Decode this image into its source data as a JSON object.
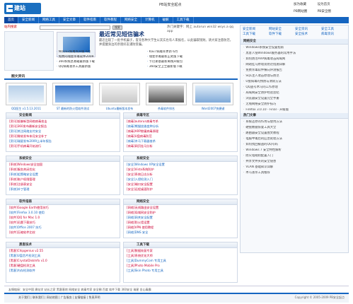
{
  "header": {
    "logo_text": "建站",
    "site_title": "PB站安全起点",
    "top_links": [
      "加为收藏",
      "设为首页",
      "PB网站圈",
      "PB安全圈"
    ]
  },
  "nav": {
    "items": [
      "首页",
      "安全新闻",
      "网络工具",
      "安全文章",
      "软件指南",
      "软件教程",
      "网络安全",
      "计算机",
      "破解",
      "工具下载"
    ]
  },
  "search": {
    "label": "站内搜索",
    "placeholder": "",
    "button": "搜索",
    "hot": "热门关键字：网上 autorun win32 wsys.a qq app"
  },
  "feature": {
    "title": "最近常见短信骗术",
    "text": "最近出现了一批手机骗子，冒充各种大学生以其实也有人来报名，以此骗取钱财。请大家注意防范，并提醒身边的亲朋好友谨防受骗。"
  },
  "list_a": [
    [
      "NOD32病毒库升级 6月",
      "Kav7病毒库更新 6月"
    ],
    [
      "免费的瑞星杀毒软件2009",
      "瑞星杀毒最新正式版下载"
    ],
    [
      "360系统急救箱最新版下载",
      "卡巴斯基最新离线升级包"
    ],
    [
      "QQ病毒查杀工具最新版",
      "360安全卫士最新版下载"
    ]
  ],
  "pictures": {
    "heading": "图文资讯",
    "captions": [
      "QQ医生 v1.5.13.2011",
      "ST 最新的防火墙软件测试",
      "Ubuntu最新版本发布",
      "杀毒软件排名",
      "Word2007快捷键"
    ]
  },
  "sidebar": {
    "tags": [
      "安全新闻",
      "网站安全",
      "安全资讯",
      "安全工具",
      "工具下载",
      "软件下载",
      "安全技术",
      "病毒资讯"
    ],
    "hot_title": "网络安全",
    "hot_items": [
      "Windows系统安全设置指南",
      "黑客入侵Windows服务器的常用手法",
      "如何防范ARP病毒攻击局域网",
      "网站挂马原理及防范措施详解",
      "免费杀毒软件横向评测报告",
      "SQL注入攻击原理与防范",
      "U盘病毒的预防与清除方法",
      "QQ盗号木马的工作原理",
      "局域网安全防护经验总结",
      "浏览器安全设置完全手册",
      "无线网络安全防护技巧",
      "Firefox 3.0.10 - Final - 升级版"
    ],
    "rank_title": "热门文章",
    "rank_items": [
      "系统还原的作用与使用方法",
      "硬盘数据恢复工具大全",
      "路由器安全设置图文教程",
      "电脑中毒后的应急处理方法",
      "如何找回被盗的QQ号码",
      "Windows 7 安全特性解析",
      "防火墙规则配置入门",
      "共享文件夹的安全隐患",
      "VLAN 基础知识详解",
      "木马查杀工具推荐"
    ]
  },
  "panels": [
    {
      "title": "安全新闻",
      "rows": [
        "[资讯]抵御新型网络病毒攻击",
        "[资讯]360发布最新安全报告",
        "[资讯]关注网络支付安全",
        "[资讯]微软发布本月安全补丁",
        "[资讯]瑞星发布2009上半年报告",
        "[资讯]手机病毒开始流行"
      ]
    },
    {
      "title": "病毒专区",
      "rows": [
        "[病毒]autorun病毒专杀",
        "[病毒]熊猫烧香变种分析",
        "[病毒]ARP欺骗病毒原理",
        "[病毒]U盘病毒防范",
        "[病毒]木马下载器查杀",
        "[病毒]网页挂马分析"
      ]
    },
    {
      "title": "系统安全",
      "rows": [
        "[系统]Windows安全加固",
        "[系统]服务关闭优化",
        "[系统]组策略安全设置",
        "[系统]账户权限管理",
        "[系统]注册表安全",
        "[系统]补丁管理"
      ]
    },
    {
      "title": "系统安全",
      "rows": [
        "[安全]Windows XP安全设置",
        "[安全]Vista系统防护",
        "[安全]系统日志分析",
        "[安全]入侵检测入门",
        "[安全]端口安全配置",
        "[安全]远程桌面防护"
      ]
    },
    {
      "title": "软件指南",
      "rows": [
        "[软件]Google Earth使用技巧",
        "[软件]Firefox 3.0.10 使用",
        "[软件]QQ for Mac 1.0",
        "[软件]迅雷下载技巧",
        "[软件]Office 2007 技巧",
        "[软件]压缩软件比较"
      ]
    },
    {
      "title": "网络安全",
      "rows": [
        "[网络]无线路由安全设置",
        "[网络]局域网安全防护",
        "[网络]网关安全配置",
        "[网络]防火墙设置",
        "[网络]VPN 使用教程",
        "[网络]DNS 安全"
      ]
    },
    {
      "title": "黑客技术",
      "rows": [
        "[黑客]Chipgenius v2.55",
        "[黑客]U盘芯片检测工具",
        "[黑客]CrystalDiskInfo v1.0",
        "[黑客]硬盘检测工具",
        "[黑客]内存检测软件"
      ]
    },
    {
      "title": "工具下载",
      "rows": [
        "[工具]数据恢复专家",
        "[工具]系统优化大师",
        "[工具]DummyCom 专用工具",
        "[工具]Photo Mobile Pro",
        "[工具]Skin Photo 专用工具"
      ]
    }
  ],
  "friend_links": "友情链接：安全中国  建站学  站长之家  黑客基地  网络安全  病毒专家  安全圈  百度  软件下载  360安全  瑞星  金山毒霸",
  "footer": {
    "links": "关于我们 | 联系我们 | 网站地图 | 广告服务 | 友情链接 | 免责声明",
    "copyright": "Copyright © 2005-2009 PB安全起点"
  },
  "colors": {
    "brand": "#1565c0",
    "accent": "#c03"
  }
}
